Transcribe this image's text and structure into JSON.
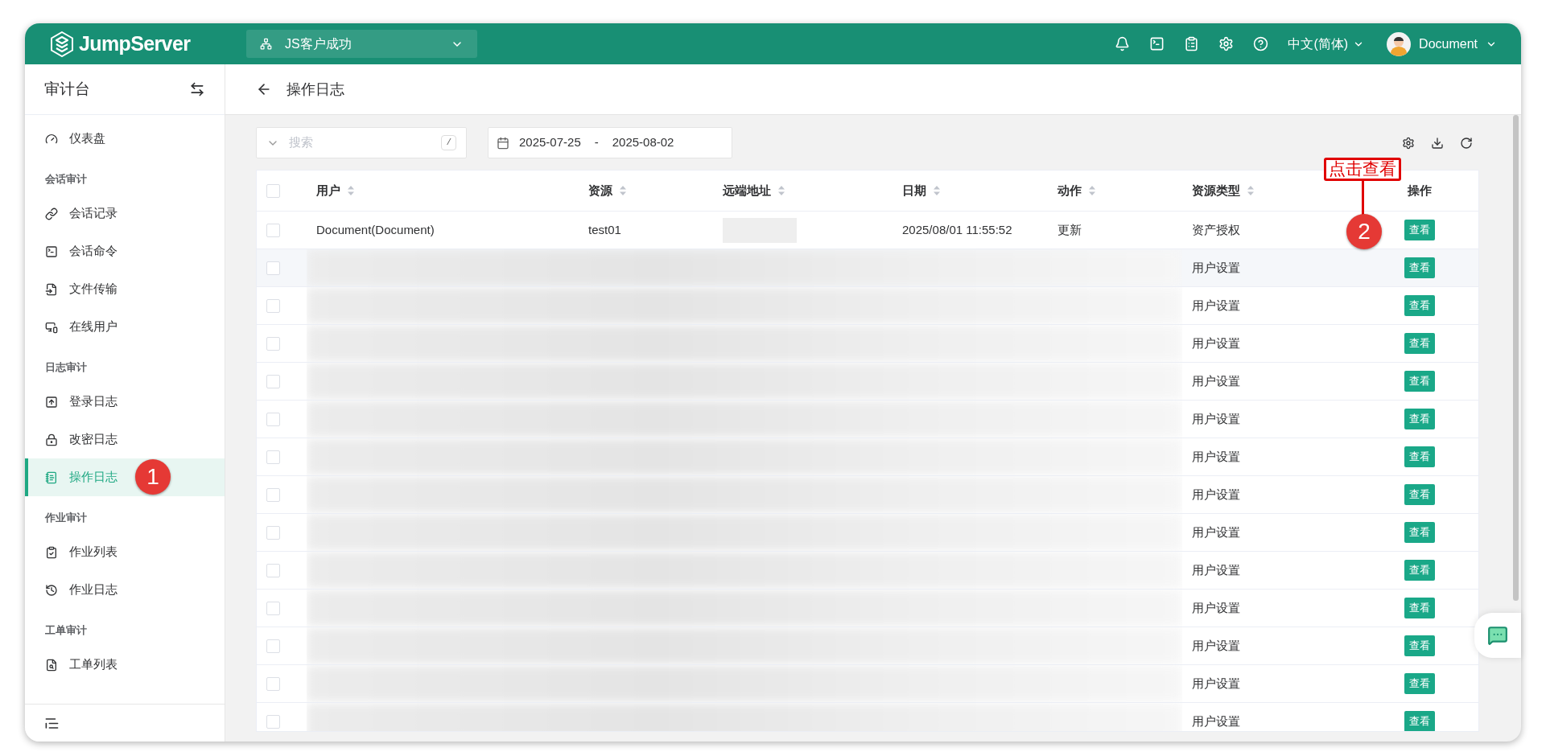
{
  "topbar": {
    "logo": "JumpServer",
    "org": "JS客户成功",
    "language": "中文(简体)",
    "user": "Document"
  },
  "sidebar": {
    "title": "审计台",
    "sections": [
      {
        "items": [
          {
            "label": "仪表盘",
            "selected": false
          }
        ]
      },
      {
        "heading": "会话审计",
        "items": [
          {
            "label": "会话记录",
            "selected": false
          },
          {
            "label": "会话命令",
            "selected": false
          },
          {
            "label": "文件传输",
            "selected": false
          },
          {
            "label": "在线用户",
            "selected": false
          }
        ]
      },
      {
        "heading": "日志审计",
        "items": [
          {
            "label": "登录日志",
            "selected": false
          },
          {
            "label": "改密日志",
            "selected": false
          },
          {
            "label": "操作日志",
            "selected": true
          }
        ]
      },
      {
        "heading": "作业审计",
        "items": [
          {
            "label": "作业列表",
            "selected": false
          },
          {
            "label": "作业日志",
            "selected": false
          }
        ]
      },
      {
        "heading": "工单审计",
        "items": [
          {
            "label": "工单列表",
            "selected": false
          }
        ]
      }
    ]
  },
  "page": {
    "title": "操作日志"
  },
  "toolbar": {
    "search_placeholder": "搜索",
    "shortcut": "/",
    "date_from": "2025-07-25",
    "date_separator": "-",
    "date_to": "2025-08-02"
  },
  "table": {
    "all_checked": false,
    "columns": [
      {
        "label": "用户",
        "sortable": true
      },
      {
        "label": "资源",
        "sortable": true
      },
      {
        "label": "远端地址",
        "sortable": true
      },
      {
        "label": "日期",
        "sortable": true
      },
      {
        "label": "动作",
        "sortable": true
      },
      {
        "label": "资源类型",
        "sortable": true
      },
      {
        "label": "操作",
        "sortable": false
      }
    ],
    "rows": [
      {
        "checked": false,
        "hovered": false,
        "redacted": false,
        "user": "Document(Document)",
        "resource": "test01",
        "address_redacted": true,
        "date": "2025/08/01 11:55:52",
        "action": "更新",
        "resource_type": "资产授权",
        "button": "查看"
      },
      {
        "checked": false,
        "hovered": true,
        "redacted": true,
        "resource_type": "用户设置",
        "button": "查看"
      },
      {
        "checked": false,
        "hovered": false,
        "redacted": true,
        "resource_type": "用户设置",
        "button": "查看"
      },
      {
        "checked": false,
        "hovered": false,
        "redacted": true,
        "resource_type": "用户设置",
        "button": "查看"
      },
      {
        "checked": false,
        "hovered": false,
        "redacted": true,
        "resource_type": "用户设置",
        "button": "查看"
      },
      {
        "checked": false,
        "hovered": false,
        "redacted": true,
        "resource_type": "用户设置",
        "button": "查看"
      },
      {
        "checked": false,
        "hovered": false,
        "redacted": true,
        "resource_type": "用户设置",
        "button": "查看"
      },
      {
        "checked": false,
        "hovered": false,
        "redacted": true,
        "resource_type": "用户设置",
        "button": "查看"
      },
      {
        "checked": false,
        "hovered": false,
        "redacted": true,
        "resource_type": "用户设置",
        "button": "查看"
      },
      {
        "checked": false,
        "hovered": false,
        "redacted": true,
        "resource_type": "用户设置",
        "button": "查看"
      },
      {
        "checked": false,
        "hovered": false,
        "redacted": true,
        "resource_type": "用户设置",
        "button": "查看"
      },
      {
        "checked": false,
        "hovered": false,
        "redacted": true,
        "resource_type": "用户设置",
        "button": "查看"
      },
      {
        "checked": false,
        "hovered": false,
        "redacted": true,
        "resource_type": "用户设置",
        "button": "查看"
      },
      {
        "checked": false,
        "hovered": false,
        "redacted": true,
        "resource_type": "用户设置",
        "button": "查看"
      }
    ]
  },
  "annotations": [
    {
      "kind": "badge",
      "text": "1"
    },
    {
      "kind": "callout",
      "label": "点击查看",
      "badge": "2"
    }
  ]
}
